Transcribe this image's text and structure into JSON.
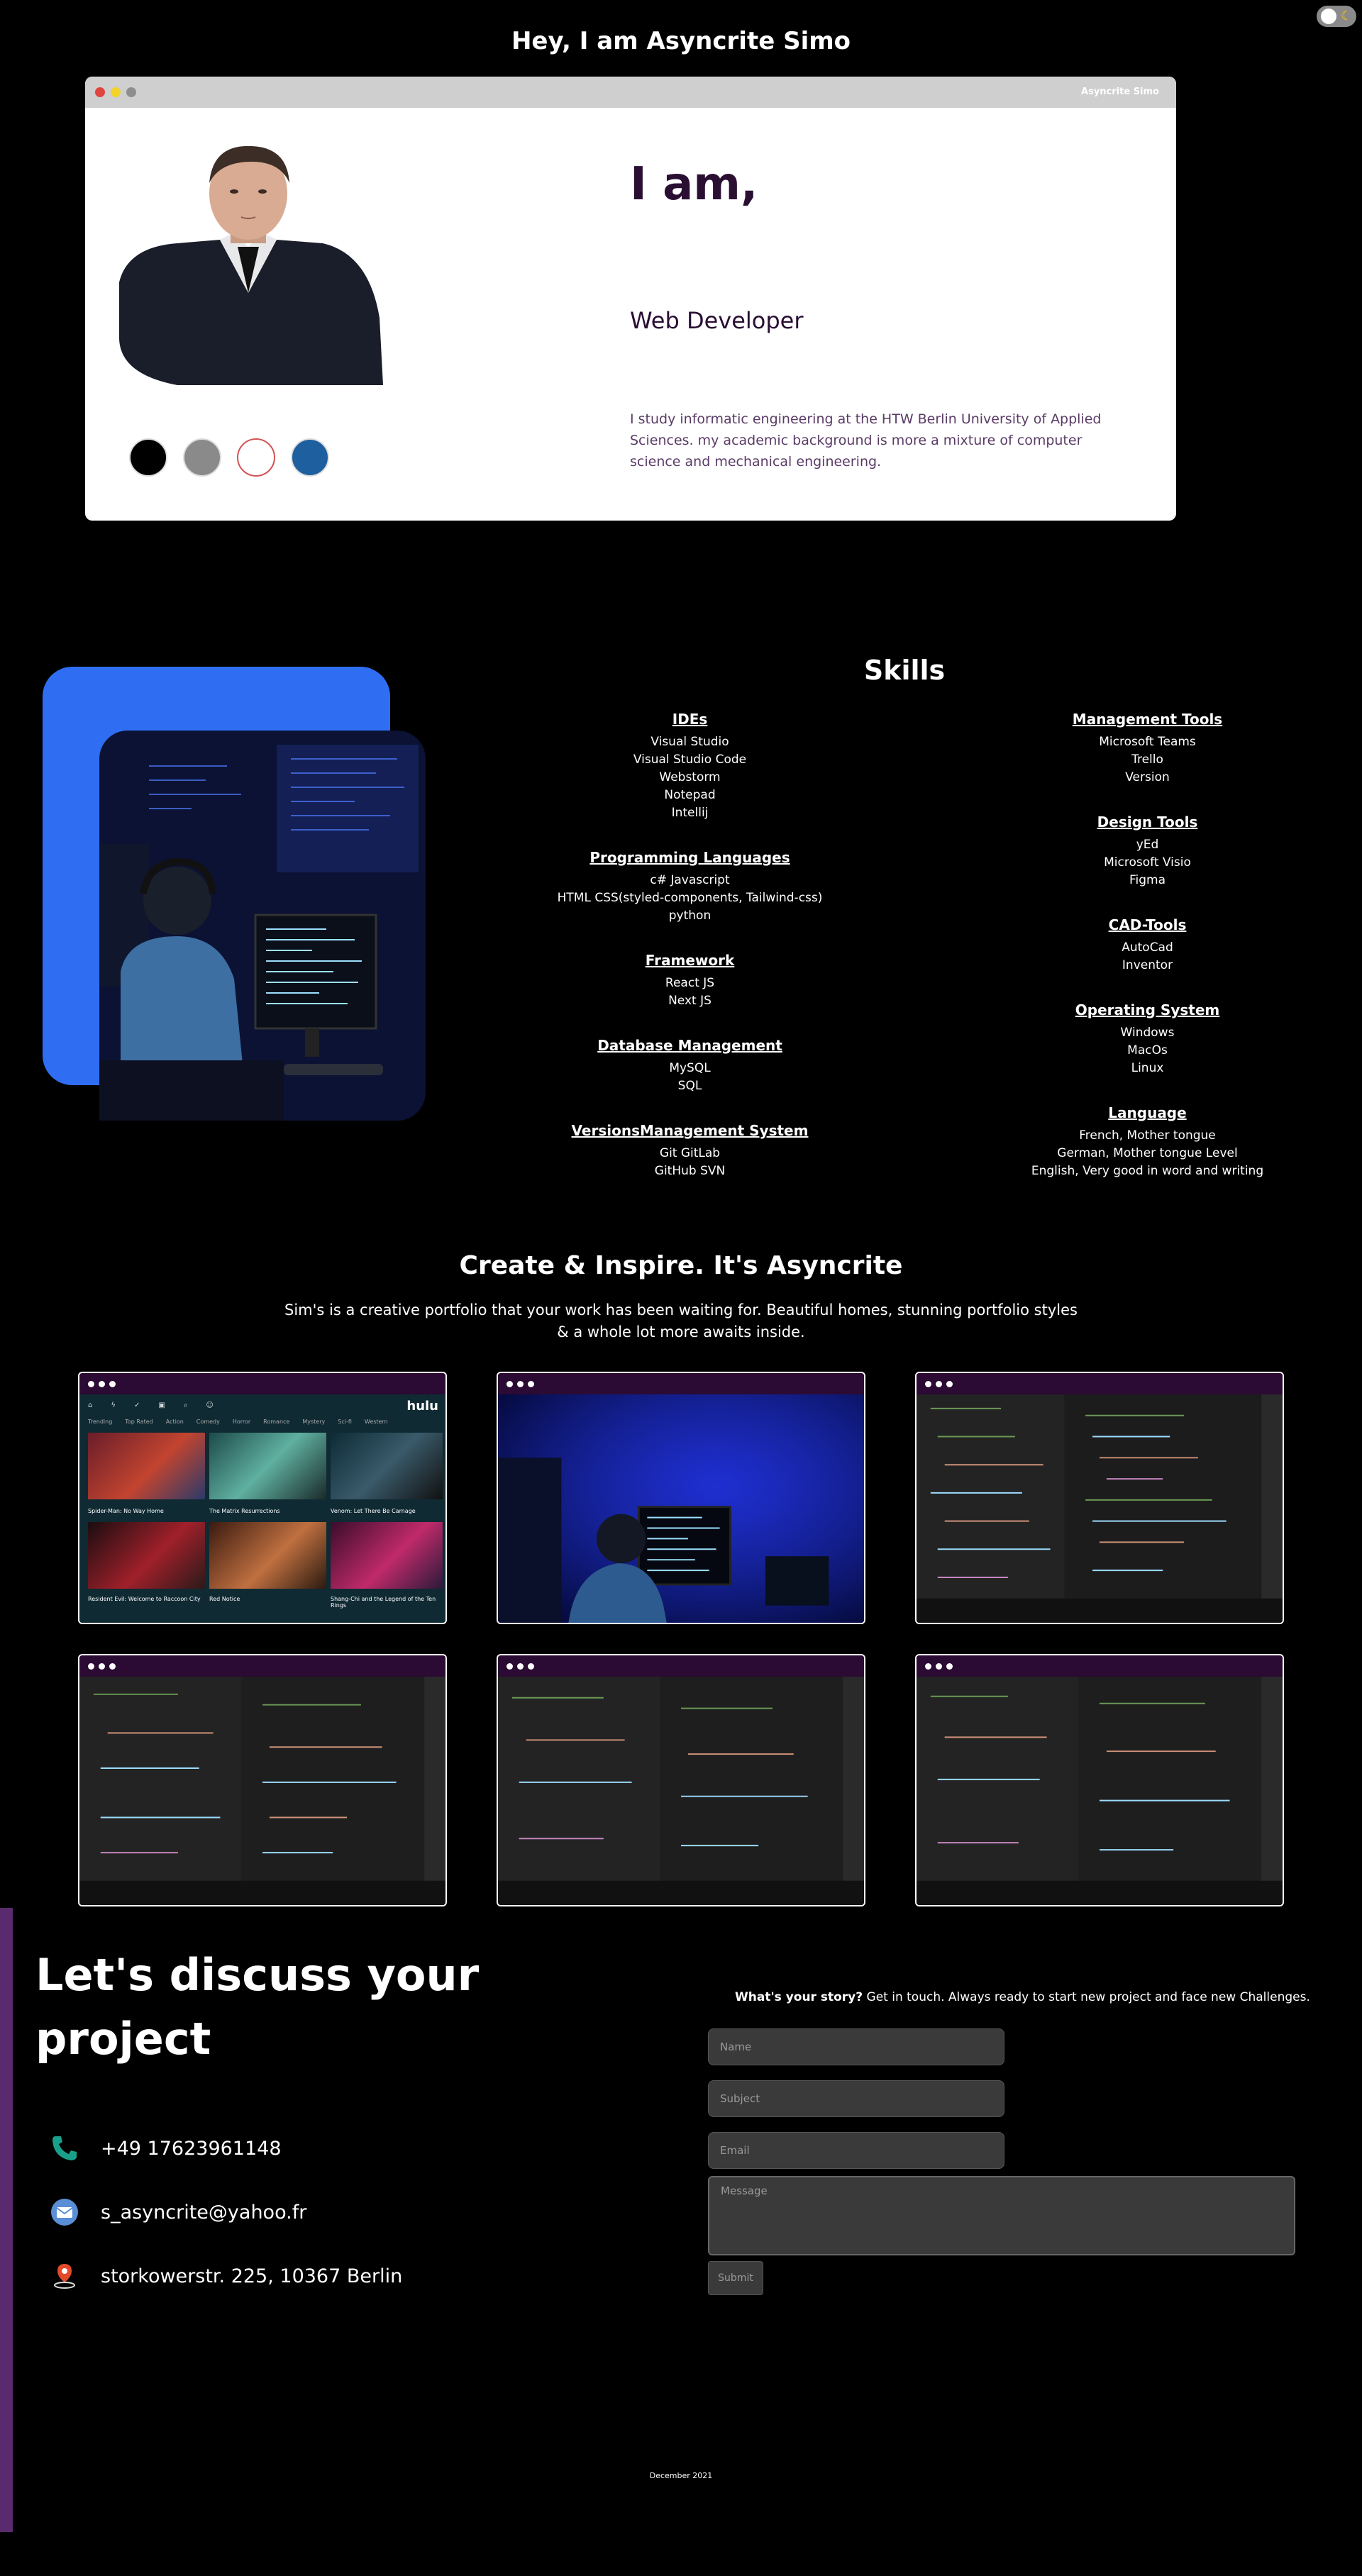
{
  "hero": {
    "heading": "Hey, I am Asyncrite Simo",
    "window_title": "Asyncrite Simo",
    "iam": "I am,",
    "role": "Web Developer",
    "bio": "I study informatic engineering at the HTW Berlin University of Applied Sciences. my academic background is more a mixture of computer science and mechanical engineering.",
    "swatches": [
      "#000000",
      "#8a8a8a",
      "#ffffff",
      "#1e5fa0"
    ]
  },
  "skills": {
    "title": "Skills",
    "left": [
      {
        "heading": "IDEs",
        "items": [
          "Visual Studio",
          "Visual Studio Code",
          "Webstorm",
          "Notepad",
          "Intellij"
        ]
      },
      {
        "heading": "Programming Languages",
        "items": [
          "c# Javascript",
          "HTML CSS(styled-components, Tailwind-css)",
          "python"
        ]
      },
      {
        "heading": "Framework",
        "items": [
          "React JS",
          "Next JS"
        ]
      },
      {
        "heading": "Database Management",
        "items": [
          "MySQL",
          "SQL"
        ]
      },
      {
        "heading": "VersionsManagement System",
        "items": [
          "Git GitLab",
          "GitHub SVN"
        ]
      }
    ],
    "right": [
      {
        "heading": "Management Tools",
        "items": [
          "Microsoft Teams",
          "Trello",
          "Version"
        ]
      },
      {
        "heading": "Design Tools",
        "items": [
          "yEd",
          "Microsoft Visio",
          "Figma"
        ]
      },
      {
        "heading": "CAD-Tools",
        "items": [
          "AutoCad",
          "Inventor"
        ]
      },
      {
        "heading": "Operating System",
        "items": [
          "Windows",
          "MacOs",
          "Linux"
        ]
      },
      {
        "heading": "Language",
        "items": [
          "French, Mother tongue",
          "German, Mother tongue Level",
          "English, Very good in word and writing"
        ]
      }
    ]
  },
  "portfolio": {
    "title": "Create & Inspire. It's Asyncrite",
    "subtitle": "Sim's is a creative portfolio that your work has been waiting for. Beautiful homes, stunning portfolio styles & a whole lot more awaits inside.",
    "hulu": {
      "brand": "hulu",
      "nav": [
        "Trending",
        "Top Rated",
        "Action",
        "Comedy",
        "Horror",
        "Romance",
        "Mystery",
        "Sci-fi",
        "Western"
      ],
      "movies": [
        "Spider-Man: No Way Home",
        "The Matrix Resurrections",
        "Venom: Let There Be Carnage",
        "Resident Evil: Welcome to Raccoon City",
        "Red Notice",
        "Shang-Chi and the Legend of the Ten Rings"
      ]
    }
  },
  "contact": {
    "heading": "Let's discuss your project",
    "phone": "+49 17623961148",
    "email": "s_asyncrite@yahoo.fr",
    "address": "storkowerstr. 225, 10367 Berlin",
    "intro_bold": "What's your story?",
    "intro_rest": " Get in touch. Always ready to start new project and face new Challenges.",
    "name_placeholder": "Name",
    "subject_placeholder": "Subject",
    "email_placeholder": "Email",
    "message_placeholder": "Message",
    "submit": "Submit"
  },
  "footer": {
    "date": "December 2021"
  }
}
